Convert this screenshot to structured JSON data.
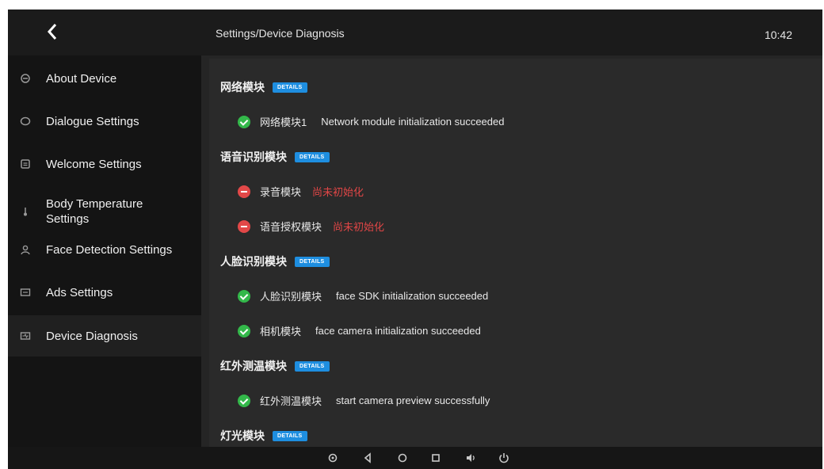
{
  "header": {
    "back_icon": "chevron-left-icon",
    "breadcrumb": "Settings/Device Diagnosis",
    "time": "10:42"
  },
  "sidebar": {
    "items": [
      {
        "label": "About Device",
        "icon": "device-icon",
        "active": false
      },
      {
        "label": "Dialogue Settings",
        "icon": "chat-icon",
        "active": false
      },
      {
        "label": "Welcome Settings",
        "icon": "welcome-icon",
        "active": false
      },
      {
        "label": "Body Temperature Settings",
        "icon": "thermometer-icon",
        "active": false
      },
      {
        "label": "Face Detection Settings",
        "icon": "person-icon",
        "active": false
      },
      {
        "label": "Ads Settings",
        "icon": "ads-icon",
        "active": false
      },
      {
        "label": "Device Diagnosis",
        "icon": "diagnosis-icon",
        "active": true
      }
    ]
  },
  "details_label": "DETAILS",
  "sections": [
    {
      "title": "网络模块",
      "rows": [
        {
          "module": "网络模块1",
          "status": "ok",
          "message": "Network module initialization succeeded"
        }
      ]
    },
    {
      "title": "语音识别模块",
      "rows": [
        {
          "module": "录音模块",
          "status": "error",
          "message": "尚未初始化"
        },
        {
          "module": "语音授权模块",
          "status": "error",
          "message": "尚未初始化"
        }
      ]
    },
    {
      "title": "人脸识别模块",
      "rows": [
        {
          "module": "人脸识别模块",
          "status": "ok",
          "message": "face SDK initialization succeeded"
        },
        {
          "module": "相机模块",
          "status": "ok",
          "message": "face camera initialization succeeded"
        }
      ]
    },
    {
      "title": "红外测温模块",
      "rows": [
        {
          "module": "红外测温模块",
          "status": "ok",
          "message": "start camera preview successfully"
        }
      ]
    },
    {
      "title": "灯光模块",
      "rows": []
    }
  ],
  "colors": {
    "accent": "#1e8ee0",
    "success": "#33b84a",
    "error": "#e04646",
    "background": "#1c1c1c"
  },
  "system_bar": {
    "buttons": [
      "settings-icon",
      "back-triangle-icon",
      "home-circle-icon",
      "recents-square-icon",
      "volume-icon",
      "power-icon"
    ]
  }
}
